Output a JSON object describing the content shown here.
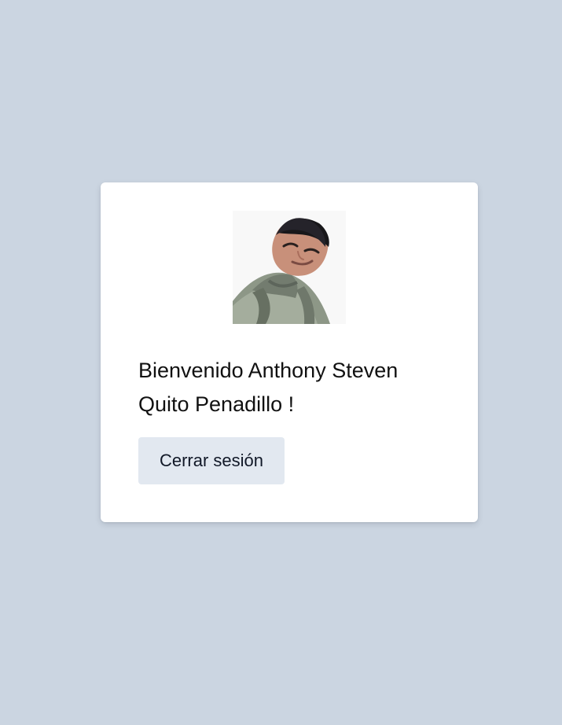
{
  "profile": {
    "avatar_icon": "user-photo",
    "welcome_text": "Bienvenido Anthony Steven Quito Penadillo !"
  },
  "actions": {
    "logout_label": "Cerrar sesión"
  },
  "colors": {
    "background": "#cbd5e1",
    "card": "#ffffff",
    "button": "#e2e8f0",
    "text": "#111111"
  }
}
